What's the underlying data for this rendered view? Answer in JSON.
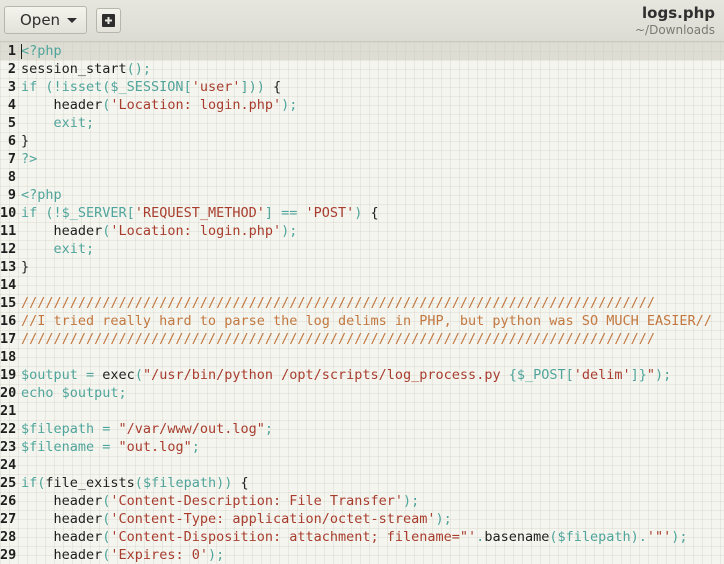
{
  "header": {
    "open_label": "Open",
    "new_tab_icon": "new-document-icon",
    "file_name": "logs.php",
    "file_path": "~/Downloads"
  },
  "editor": {
    "current_line": 1,
    "lines": [
      {
        "n": "1",
        "segs": [
          {
            "t": "<?php",
            "c": "k"
          }
        ]
      },
      {
        "n": "2",
        "segs": [
          {
            "t": "session_start",
            "c": "d"
          },
          {
            "t": "();",
            "c": "k"
          }
        ]
      },
      {
        "n": "3",
        "segs": [
          {
            "t": "if (!isset(",
            "c": "k"
          },
          {
            "t": "$_SESSION",
            "c": "k"
          },
          {
            "t": "[",
            "c": "k"
          },
          {
            "t": "'user'",
            "c": "s"
          },
          {
            "t": "])) ",
            "c": "k"
          },
          {
            "t": "{",
            "c": "d"
          }
        ]
      },
      {
        "n": "4",
        "segs": [
          {
            "t": "    header",
            "c": "d"
          },
          {
            "t": "(",
            "c": "k"
          },
          {
            "t": "'Location: login.php'",
            "c": "s"
          },
          {
            "t": ");",
            "c": "k"
          }
        ]
      },
      {
        "n": "5",
        "segs": [
          {
            "t": "    exit;",
            "c": "k"
          }
        ]
      },
      {
        "n": "6",
        "segs": [
          {
            "t": "}",
            "c": "d"
          }
        ]
      },
      {
        "n": "7",
        "segs": [
          {
            "t": "?>",
            "c": "k"
          }
        ]
      },
      {
        "n": "8",
        "segs": []
      },
      {
        "n": "9",
        "segs": [
          {
            "t": "<?php",
            "c": "k"
          }
        ]
      },
      {
        "n": "10",
        "segs": [
          {
            "t": "if (!",
            "c": "k"
          },
          {
            "t": "$_SERVER",
            "c": "k"
          },
          {
            "t": "[",
            "c": "k"
          },
          {
            "t": "'REQUEST_METHOD'",
            "c": "s"
          },
          {
            "t": "] == ",
            "c": "k"
          },
          {
            "t": "'POST'",
            "c": "s"
          },
          {
            "t": ") ",
            "c": "k"
          },
          {
            "t": "{",
            "c": "d"
          }
        ]
      },
      {
        "n": "11",
        "segs": [
          {
            "t": "    header",
            "c": "d"
          },
          {
            "t": "(",
            "c": "k"
          },
          {
            "t": "'Location: login.php'",
            "c": "s"
          },
          {
            "t": ");",
            "c": "k"
          }
        ]
      },
      {
        "n": "12",
        "segs": [
          {
            "t": "    exit;",
            "c": "k"
          }
        ]
      },
      {
        "n": "13",
        "segs": [
          {
            "t": "}",
            "c": "d"
          }
        ]
      },
      {
        "n": "14",
        "segs": []
      },
      {
        "n": "15",
        "segs": [
          {
            "t": "//////////////////////////////////////////////////////////////////////////////",
            "c": "c"
          }
        ]
      },
      {
        "n": "16",
        "segs": [
          {
            "t": "//I tried really hard to parse the log delims in PHP, but python was SO MUCH EASIER//",
            "c": "c"
          }
        ]
      },
      {
        "n": "17",
        "segs": [
          {
            "t": "//////////////////////////////////////////////////////////////////////////////",
            "c": "c"
          }
        ]
      },
      {
        "n": "18",
        "segs": []
      },
      {
        "n": "19",
        "segs": [
          {
            "t": "$output",
            "c": "k"
          },
          {
            "t": " = ",
            "c": "k"
          },
          {
            "t": "exec",
            "c": "d"
          },
          {
            "t": "(",
            "c": "k"
          },
          {
            "t": "\"/usr/bin/python /opt/scripts/log_process.py ",
            "c": "s"
          },
          {
            "t": "{$_POST[",
            "c": "k"
          },
          {
            "t": "'delim'",
            "c": "s"
          },
          {
            "t": "]}",
            "c": "k"
          },
          {
            "t": "\"",
            "c": "s"
          },
          {
            "t": ");",
            "c": "k"
          }
        ]
      },
      {
        "n": "20",
        "segs": [
          {
            "t": "echo ",
            "c": "k"
          },
          {
            "t": "$output",
            "c": "k"
          },
          {
            "t": ";",
            "c": "k"
          }
        ]
      },
      {
        "n": "21",
        "segs": []
      },
      {
        "n": "22",
        "segs": [
          {
            "t": "$filepath",
            "c": "k"
          },
          {
            "t": " = ",
            "c": "k"
          },
          {
            "t": "\"/var/www/out.log\"",
            "c": "s"
          },
          {
            "t": ";",
            "c": "k"
          }
        ]
      },
      {
        "n": "23",
        "segs": [
          {
            "t": "$filename",
            "c": "k"
          },
          {
            "t": " = ",
            "c": "k"
          },
          {
            "t": "\"out.log\"",
            "c": "s"
          },
          {
            "t": ";",
            "c": "k"
          }
        ]
      },
      {
        "n": "24",
        "segs": []
      },
      {
        "n": "25",
        "segs": [
          {
            "t": "if(",
            "c": "k"
          },
          {
            "t": "file_exists",
            "c": "d"
          },
          {
            "t": "(",
            "c": "k"
          },
          {
            "t": "$filepath",
            "c": "k"
          },
          {
            "t": ")) ",
            "c": "k"
          },
          {
            "t": "{",
            "c": "d"
          }
        ]
      },
      {
        "n": "26",
        "segs": [
          {
            "t": "    header",
            "c": "d"
          },
          {
            "t": "(",
            "c": "k"
          },
          {
            "t": "'Content-Description: File Transfer'",
            "c": "s"
          },
          {
            "t": ");",
            "c": "k"
          }
        ]
      },
      {
        "n": "27",
        "segs": [
          {
            "t": "    header",
            "c": "d"
          },
          {
            "t": "(",
            "c": "k"
          },
          {
            "t": "'Content-Type: application/octet-stream'",
            "c": "s"
          },
          {
            "t": ");",
            "c": "k"
          }
        ]
      },
      {
        "n": "28",
        "segs": [
          {
            "t": "    header",
            "c": "d"
          },
          {
            "t": "(",
            "c": "k"
          },
          {
            "t": "'Content-Disposition: attachment; filename=\"'",
            "c": "s"
          },
          {
            "t": ".",
            "c": "k"
          },
          {
            "t": "basename",
            "c": "d"
          },
          {
            "t": "(",
            "c": "k"
          },
          {
            "t": "$filepath",
            "c": "k"
          },
          {
            "t": ").",
            "c": "k"
          },
          {
            "t": "'\"'",
            "c": "s"
          },
          {
            "t": ");",
            "c": "k"
          }
        ]
      },
      {
        "n": "29",
        "segs": [
          {
            "t": "    header",
            "c": "d"
          },
          {
            "t": "(",
            "c": "k"
          },
          {
            "t": "'Expires: 0'",
            "c": "s"
          },
          {
            "t": ");",
            "c": "k"
          }
        ]
      }
    ]
  }
}
